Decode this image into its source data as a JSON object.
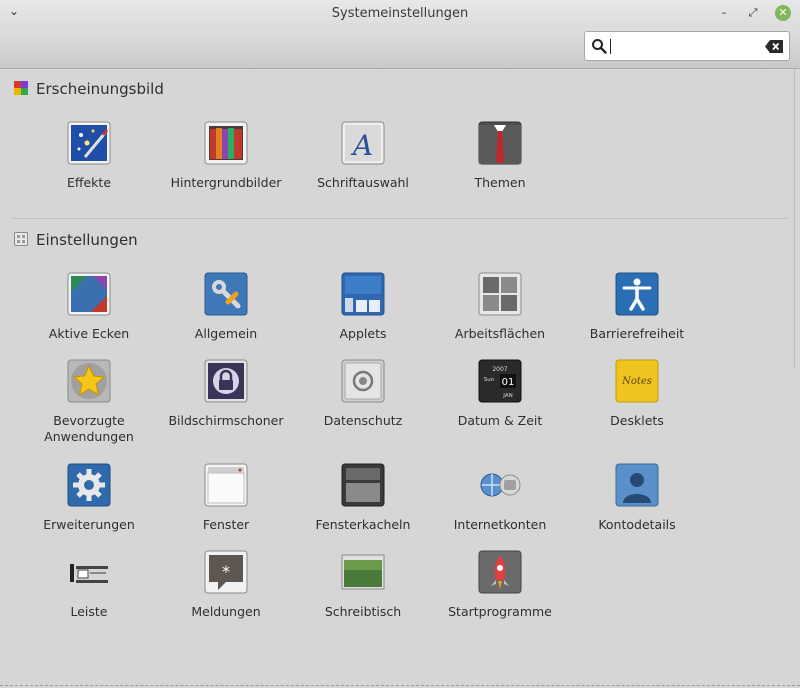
{
  "window": {
    "title": "Systemeinstellungen",
    "menu_glyph": "⌄",
    "minimize_glyph": "–",
    "maximize_glyph": "⤢",
    "close_glyph": "✕"
  },
  "search": {
    "value": "",
    "placeholder": ""
  },
  "sections": [
    {
      "title": "Erscheinungsbild",
      "icon": "palette-icon",
      "items": [
        {
          "label": "Effekte",
          "icon": "effects-icon"
        },
        {
          "label": "Hintergrundbilder",
          "icon": "wallpaper-icon"
        },
        {
          "label": "Schriftauswahl",
          "icon": "font-icon"
        },
        {
          "label": "Themen",
          "icon": "themes-icon"
        }
      ]
    },
    {
      "title": "Einstellungen",
      "icon": "settings-grid-icon",
      "items": [
        {
          "label": "Aktive Ecken",
          "icon": "hot-corners-icon"
        },
        {
          "label": "Allgemein",
          "icon": "general-icon"
        },
        {
          "label": "Applets",
          "icon": "applets-icon"
        },
        {
          "label": "Arbeitsflächen",
          "icon": "workspaces-icon"
        },
        {
          "label": "Barrierefreiheit",
          "icon": "accessibility-icon"
        },
        {
          "label": "Bevorzugte Anwendungen",
          "icon": "preferred-apps-icon"
        },
        {
          "label": "Bildschirmschoner",
          "icon": "screensaver-icon"
        },
        {
          "label": "Datenschutz",
          "icon": "privacy-icon"
        },
        {
          "label": "Datum & Zeit",
          "icon": "date-time-icon"
        },
        {
          "label": "Desklets",
          "icon": "desklets-icon"
        },
        {
          "label": "Erweiterungen",
          "icon": "extensions-icon"
        },
        {
          "label": "Fenster",
          "icon": "windows-icon"
        },
        {
          "label": "Fensterkacheln",
          "icon": "window-tiling-icon"
        },
        {
          "label": "Internetkonten",
          "icon": "online-accounts-icon"
        },
        {
          "label": "Kontodetails",
          "icon": "account-details-icon"
        },
        {
          "label": "Leiste",
          "icon": "panel-icon"
        },
        {
          "label": "Meldungen",
          "icon": "notifications-icon"
        },
        {
          "label": "Schreibtisch",
          "icon": "desktop-icon"
        },
        {
          "label": "Startprogramme",
          "icon": "startup-apps-icon"
        }
      ]
    }
  ],
  "icon_text": {
    "font_letter": "A",
    "cal_year": "2007",
    "cal_day": "Sun",
    "cal_date": "01",
    "cal_month": "JAN",
    "note_text": "Notes",
    "notify_glyph": "*"
  }
}
